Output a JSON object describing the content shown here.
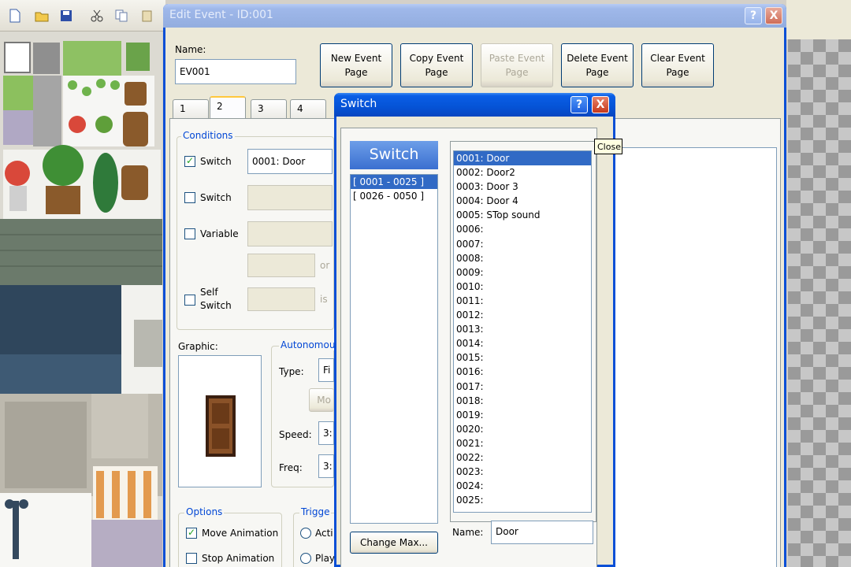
{
  "edit_event": {
    "title": "Edit Event - ID:001",
    "name_label": "Name:",
    "name_value": "EV001",
    "buttons": {
      "new_page": "New Event Page",
      "copy_page": "Copy Event Page",
      "paste_page": "Paste Event Page",
      "delete_page": "Delete Event Page",
      "clear_page": "Clear Event Page"
    },
    "tabs": [
      "1",
      "2",
      "3",
      "4"
    ],
    "active_tab": "2",
    "conditions": {
      "title": "Conditions",
      "switch1_label": "Switch",
      "switch1_checked": true,
      "switch1_value": "0001: Door",
      "switch2_label": "Switch",
      "variable_label": "Variable",
      "or_label": "or",
      "self_switch_label": "Self Switch",
      "is_label": "is"
    },
    "graphic_label": "Graphic:",
    "autonomous": {
      "title": "Autonomou",
      "type_label": "Type:",
      "type_value": "Fi",
      "move_button": "Mo",
      "speed_label": "Speed:",
      "speed_value": "3:",
      "freq_label": "Freq:",
      "freq_value": "3:"
    },
    "options": {
      "title": "Options",
      "move_animation": "Move Animation",
      "move_animation_checked": true,
      "stop_animation": "Stop Animation",
      "stop_animation_checked": false
    },
    "trigger": {
      "title": "Trigge",
      "opt1": "Acti",
      "opt2": "Play"
    }
  },
  "switch_dialog": {
    "title": "Switch",
    "header": "Switch",
    "ranges": [
      "[ 0001 - 0025 ]",
      "[ 0026 - 0050 ]"
    ],
    "selected_range": "[ 0001 - 0025 ]",
    "switches": [
      "0001: Door",
      "0002: Door2",
      "0003: Door 3",
      "0004: Door 4",
      "0005: STop sound",
      "0006:",
      "0007:",
      "0008:",
      "0009:",
      "0010:",
      "0011:",
      "0012:",
      "0013:",
      "0014:",
      "0015:",
      "0016:",
      "0017:",
      "0018:",
      "0019:",
      "0020:",
      "0021:",
      "0022:",
      "0023:",
      "0024:",
      "0025:"
    ],
    "selected_switch": "0001: Door",
    "change_max_button": "Change Max...",
    "name_label": "Name:",
    "name_value": "Door",
    "tooltip": "Close"
  },
  "icons": {
    "toolbar": [
      "new-file-icon",
      "open-folder-icon",
      "save-icon",
      "cut-icon",
      "copy-icon",
      "paste-icon"
    ],
    "help": "?",
    "close": "X"
  },
  "colors": {
    "title_bar": "#0553d6",
    "selection": "#316ac5",
    "group_title": "#0046d5",
    "window_face": "#ece9d8"
  }
}
